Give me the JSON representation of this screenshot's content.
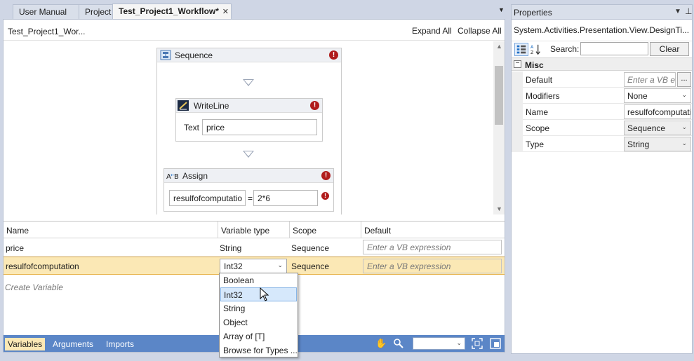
{
  "tabs": [
    {
      "label": "User Manual",
      "active": false
    },
    {
      "label": "Project",
      "active": false
    },
    {
      "label": "Test_Project1_Workflow*",
      "active": true,
      "close_glyph": "✕"
    }
  ],
  "designer": {
    "breadcrumb": "Test_Project1_Wor...",
    "expand_all": "Expand All",
    "collapse_all": "Collapse All",
    "sequence": {
      "title": "Sequence"
    },
    "writeline": {
      "title": "WriteLine",
      "text_label": "Text",
      "text_value": "price"
    },
    "assign": {
      "title": "Assign",
      "to_value": "resulfofcomputatio",
      "equals": "=",
      "value": "2*6"
    }
  },
  "variables": {
    "columns": [
      "Name",
      "Variable type",
      "Scope",
      "Default"
    ],
    "rows": [
      {
        "name": "price",
        "type": "String",
        "scope": "Sequence",
        "default_placeholder": "Enter a VB expression"
      },
      {
        "name": "resulfofcomputation",
        "type": "Int32",
        "scope": "Sequence",
        "default_placeholder": "Enter a VB expression",
        "selected": true
      }
    ],
    "create_variable": "Create Variable",
    "type_options": [
      "Boolean",
      "Int32",
      "String",
      "Object",
      "Array of [T]",
      "Browse for Types ..."
    ],
    "hovered_option": "Int32"
  },
  "bottom_tabs": [
    "Variables",
    "Arguments",
    "Imports"
  ],
  "bottom_active": "Variables",
  "properties": {
    "title": "Properties",
    "type_name": "System.Activities.Presentation.View.DesignTi...",
    "search_label": "Search:",
    "clear_label": "Clear",
    "category": "Misc",
    "items": [
      {
        "name": "Default",
        "value": "Enter a VB e...",
        "kind": "expression"
      },
      {
        "name": "Modifiers",
        "value": "None",
        "kind": "combo"
      },
      {
        "name": "Name",
        "value": "resulfofcomputati",
        "kind": "text"
      },
      {
        "name": "Scope",
        "value": "Sequence",
        "kind": "combo"
      },
      {
        "name": "Type",
        "value": "String",
        "kind": "combo"
      }
    ]
  },
  "colors": {
    "accent_bar": "#5b86c7",
    "selection": "#fbe8b5",
    "error": "#b01c1c",
    "hover": "#d6e8fb"
  }
}
